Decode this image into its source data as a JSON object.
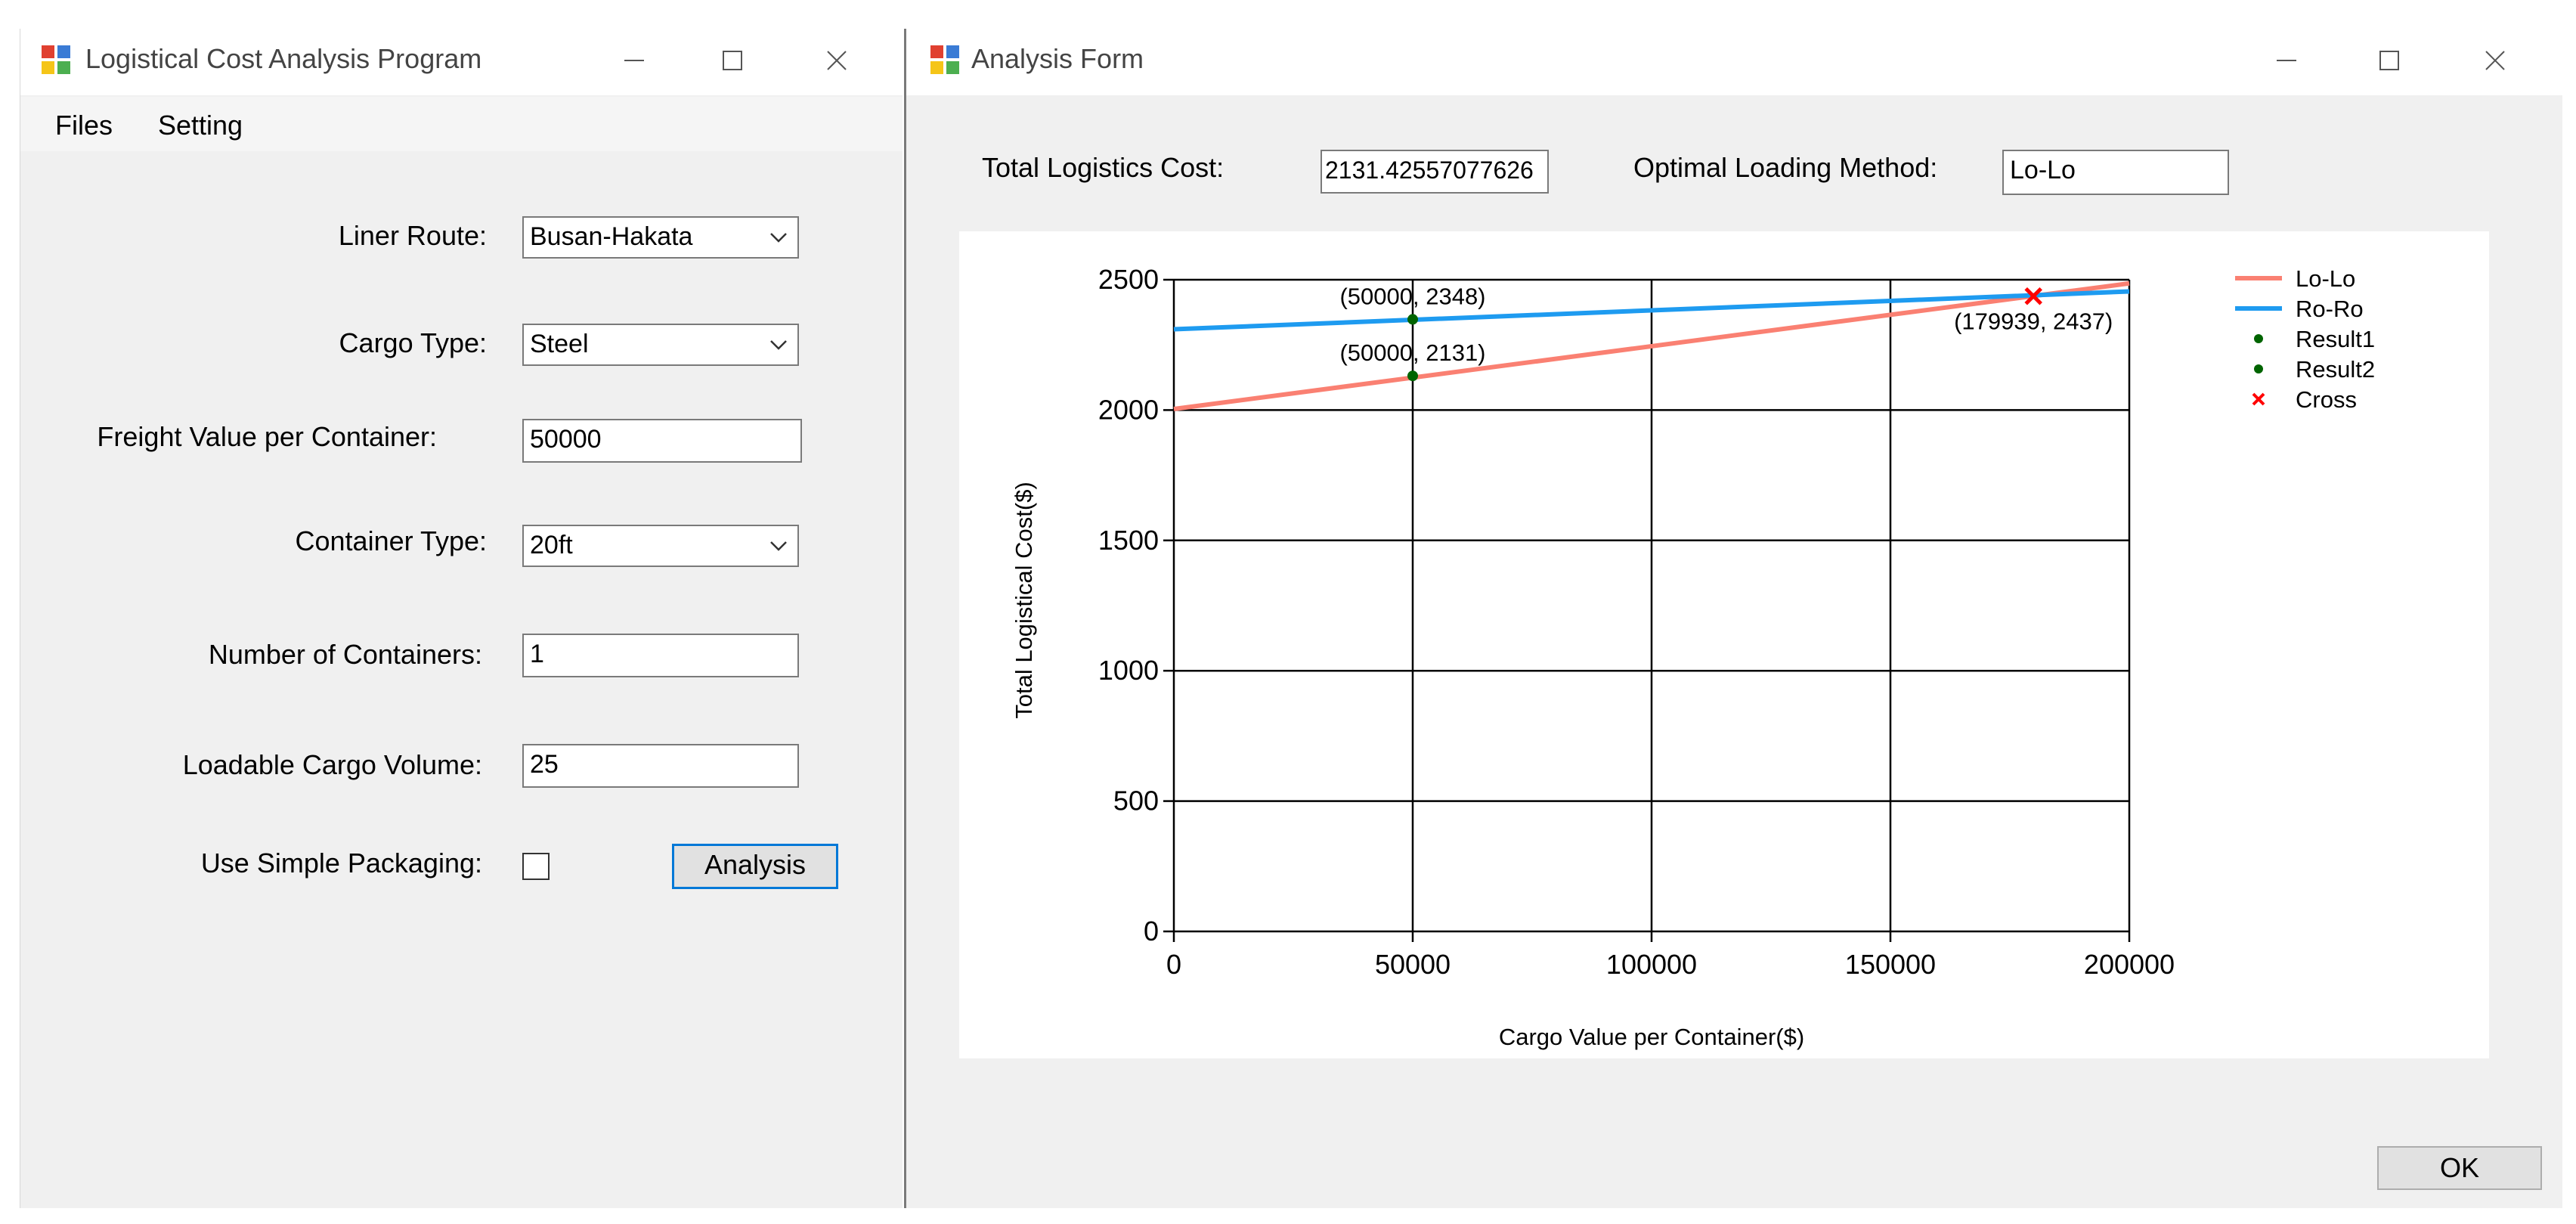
{
  "main_window": {
    "title": "Logistical Cost Analysis Program",
    "menu": [
      "Files",
      "Setting"
    ],
    "form": {
      "liner_route_label": "Liner Route:",
      "liner_route_value": "Busan-Hakata",
      "cargo_type_label": "Cargo Type:",
      "cargo_type_value": "Steel",
      "freight_value_label": "Freight Value per Container:",
      "freight_value_value": "50000",
      "container_type_label": "Container Type:",
      "container_type_value": "20ft",
      "num_containers_label": "Number of Containers:",
      "num_containers_value": "1",
      "loadable_volume_label": "Loadable Cargo Volume:",
      "loadable_volume_value": "25",
      "simple_packaging_label": "Use Simple Packaging:",
      "simple_packaging_checked": false,
      "analysis_button": "Analysis"
    }
  },
  "analysis_window": {
    "title": "Analysis Form",
    "total_cost_label": "Total Logistics Cost:",
    "total_cost_value": "2131.42557077626",
    "optimal_method_label": "Optimal Loading Method:",
    "optimal_method_value": "Lo-Lo",
    "ok_button": "OK"
  },
  "chart_data": {
    "type": "line",
    "title": "",
    "xlabel": "Cargo Value per Container($)",
    "ylabel": "Total Logistical Cost($)",
    "xlim": [
      0,
      200000
    ],
    "ylim": [
      0,
      2500
    ],
    "x_ticks": [
      0,
      50000,
      100000,
      150000,
      200000
    ],
    "y_ticks": [
      0,
      500,
      1000,
      1500,
      2000,
      2500
    ],
    "grid": true,
    "legend_position": "right",
    "series": [
      {
        "name": "Lo-Lo",
        "color": "#fa8072",
        "kind": "line",
        "points": [
          [
            0,
            2004
          ],
          [
            200000,
            2486
          ]
        ]
      },
      {
        "name": "Ro-Ro",
        "color": "#1e9bf0",
        "kind": "line",
        "points": [
          [
            0,
            2310
          ],
          [
            200000,
            2455
          ]
        ]
      },
      {
        "name": "Result1",
        "color": "#006400",
        "kind": "point",
        "points": [
          [
            50000,
            2348
          ]
        ]
      },
      {
        "name": "Result2",
        "color": "#006400",
        "kind": "point",
        "points": [
          [
            50000,
            2131
          ]
        ]
      },
      {
        "name": "Cross",
        "color": "#ff0000",
        "kind": "cross",
        "points": [
          [
            179939,
            2437
          ]
        ]
      }
    ],
    "annotations": [
      {
        "text": "(50000, 2348)",
        "x": 50000,
        "y": 2348,
        "placement": "above"
      },
      {
        "text": "(50000, 2131)",
        "x": 50000,
        "y": 2131,
        "placement": "above"
      },
      {
        "text": "(179939, 2437)",
        "x": 179939,
        "y": 2437,
        "placement": "below"
      }
    ]
  }
}
